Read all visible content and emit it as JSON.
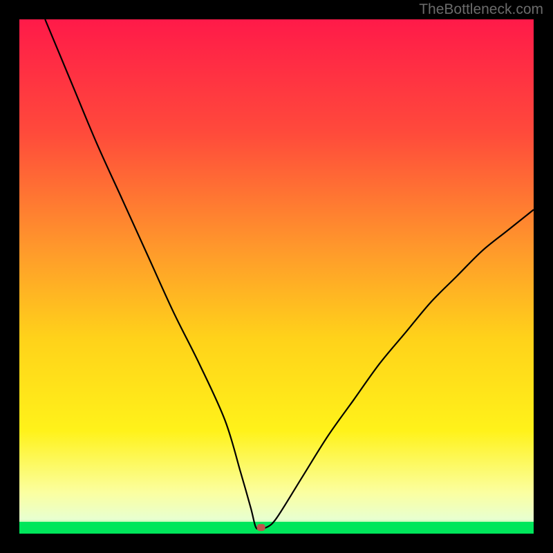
{
  "watermark": "TheBottleneck.com",
  "chart_data": {
    "type": "line",
    "title": "",
    "xlabel": "",
    "ylabel": "",
    "xlim": [
      0,
      100
    ],
    "ylim": [
      0,
      100
    ],
    "series": [
      {
        "name": "bottleneck-curve",
        "x": [
          5,
          10,
          15,
          20,
          25,
          30,
          35,
          40,
          43,
          45,
          46,
          47,
          48,
          50,
          55,
          60,
          65,
          70,
          75,
          80,
          85,
          90,
          95,
          100
        ],
        "values": [
          100,
          88,
          76,
          65,
          54,
          43,
          33,
          22,
          12,
          5,
          1.2,
          1.2,
          1.2,
          3,
          11,
          19,
          26,
          33,
          39,
          45,
          50,
          55,
          59,
          63
        ]
      }
    ],
    "marker": {
      "x": 47,
      "y": 1.2
    },
    "green_strip": {
      "y0": 0,
      "y1": 2.3
    },
    "gradient_stops": [
      {
        "offset": 0.0,
        "color": "#ff1a49"
      },
      {
        "offset": 0.22,
        "color": "#ff4a3b"
      },
      {
        "offset": 0.45,
        "color": "#ff9a2b"
      },
      {
        "offset": 0.62,
        "color": "#ffd21a"
      },
      {
        "offset": 0.8,
        "color": "#fff21a"
      },
      {
        "offset": 0.92,
        "color": "#fbffa0"
      },
      {
        "offset": 0.972,
        "color": "#e8ffd0"
      },
      {
        "offset": 0.985,
        "color": "#9df29c"
      },
      {
        "offset": 1.0,
        "color": "#00e65b"
      }
    ]
  }
}
